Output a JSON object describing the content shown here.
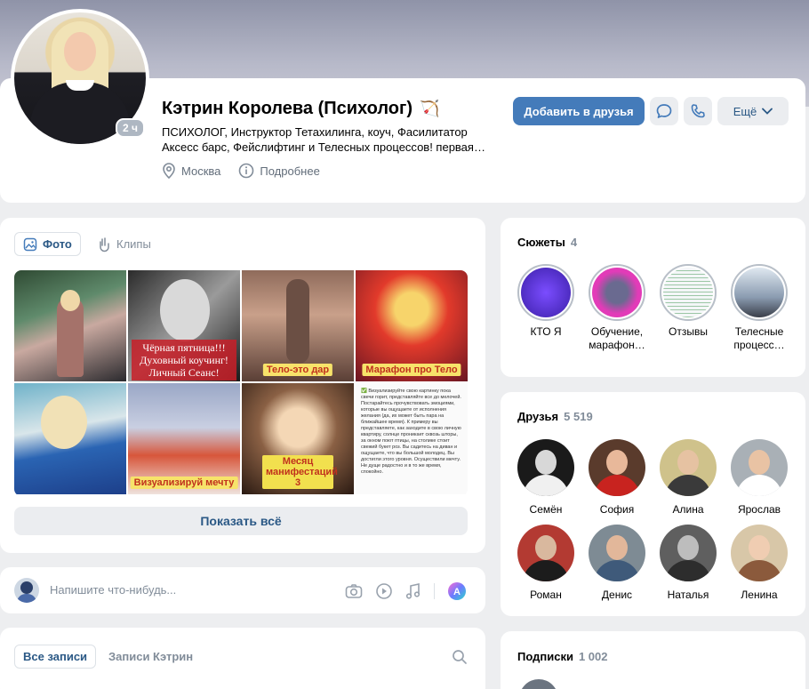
{
  "profile": {
    "name": "Кэтрин Королева (Психолог)",
    "name_emoji": "🏹",
    "status": "ПСИХОЛОГ, Инструктор Тетахилинга, коуч, Фасилитатор Аксесс барс, Фейслифтинг и Телесных процессов! первая…",
    "city": "Москва",
    "more_info": "Подробнее",
    "online_badge": "2 ч",
    "add_friend": "Добавить в друзья",
    "more": "Ещё"
  },
  "photos": {
    "tabs": [
      {
        "label": "Фото",
        "active": true
      },
      {
        "label": "Клипы",
        "active": false
      }
    ],
    "tile_texts": {
      "t2": "Чёрная пятница!!! Духовный коучинг! Личный Сеанс!",
      "t3": "Тело-это дар",
      "t4": "Марафон про Тело",
      "t6": "Визуализируй мечту",
      "t7": "Месяц манифестаций 3",
      "t8": "✅ Визуализируйте свою картинку пока свечи горит, представляйте все до мелочей. Постарайтесь прочувствовать эмоциями, которые вы ощущаете от исполнения желания (да, их может быть пара на ближайшее время). К примеру вы представляете, как заходите в свою личную квартиру, солнце проникает сквозь шторы, за окном поют птицы, на столике стоит свежий букет роз. Вы садитесь на диван и ощущаете, что вы большой молодец. Вы достигли этого уровня. Осуществили мечту. Не дуще радостно и в то же время, спокойно."
    },
    "show_all": "Показать всё"
  },
  "composer": {
    "placeholder": "Напишите что-нибудь..."
  },
  "feed": {
    "tabs": [
      {
        "label": "Все записи",
        "active": true
      },
      {
        "label": "Записи Кэтрин",
        "active": false
      }
    ]
  },
  "stories": {
    "title": "Сюжеты",
    "count": "4",
    "items": [
      {
        "caption": "КТО Я"
      },
      {
        "caption": "Обучение, марафон…"
      },
      {
        "caption": "Отзывы"
      },
      {
        "caption": "Телесные процесс…"
      }
    ]
  },
  "friends": {
    "title": "Друзья",
    "count": "5 519",
    "items": [
      {
        "name": "Семён"
      },
      {
        "name": "София"
      },
      {
        "name": "Алина"
      },
      {
        "name": "Ярослав"
      },
      {
        "name": "Роман"
      },
      {
        "name": "Денис"
      },
      {
        "name": "Наталья"
      },
      {
        "name": "Ленина"
      }
    ]
  },
  "subscriptions": {
    "title": "Подписки",
    "count": "1 002"
  },
  "colors": {
    "accent": "#447bba",
    "link": "#2a5885",
    "page_bg": "#edeef0",
    "secondary_text": "#818c99"
  }
}
